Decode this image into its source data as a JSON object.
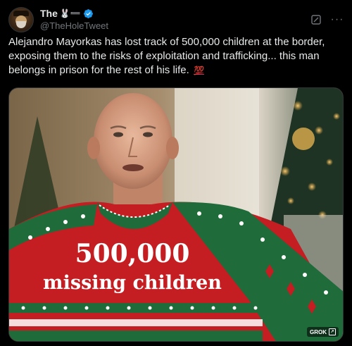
{
  "tweet": {
    "display_name": "The",
    "name_emoji": "🐰➖",
    "handle": "@TheHoleTweet",
    "text": "Alejandro Mayorkas has lost track of 500,000 children at the border, exposing them to the risks of exploitation and trafficking... this man belongs in prison for the rest of his life.",
    "text_emoji": "💯"
  },
  "media": {
    "sweater_line1": "500,000",
    "sweater_line2": "missing children",
    "badge_label": "GROK"
  },
  "colors": {
    "background": "#000000",
    "text": "#e7e9ea",
    "secondary": "#71767b",
    "verified": "#1d9bf0",
    "sweater_red": "#c41d22",
    "sweater_green": "#1f6b3a"
  },
  "icons": {
    "avatar": "avatar-icon",
    "verified": "verified-badge-icon",
    "grok": "grok-icon",
    "more": "more-options-icon"
  }
}
